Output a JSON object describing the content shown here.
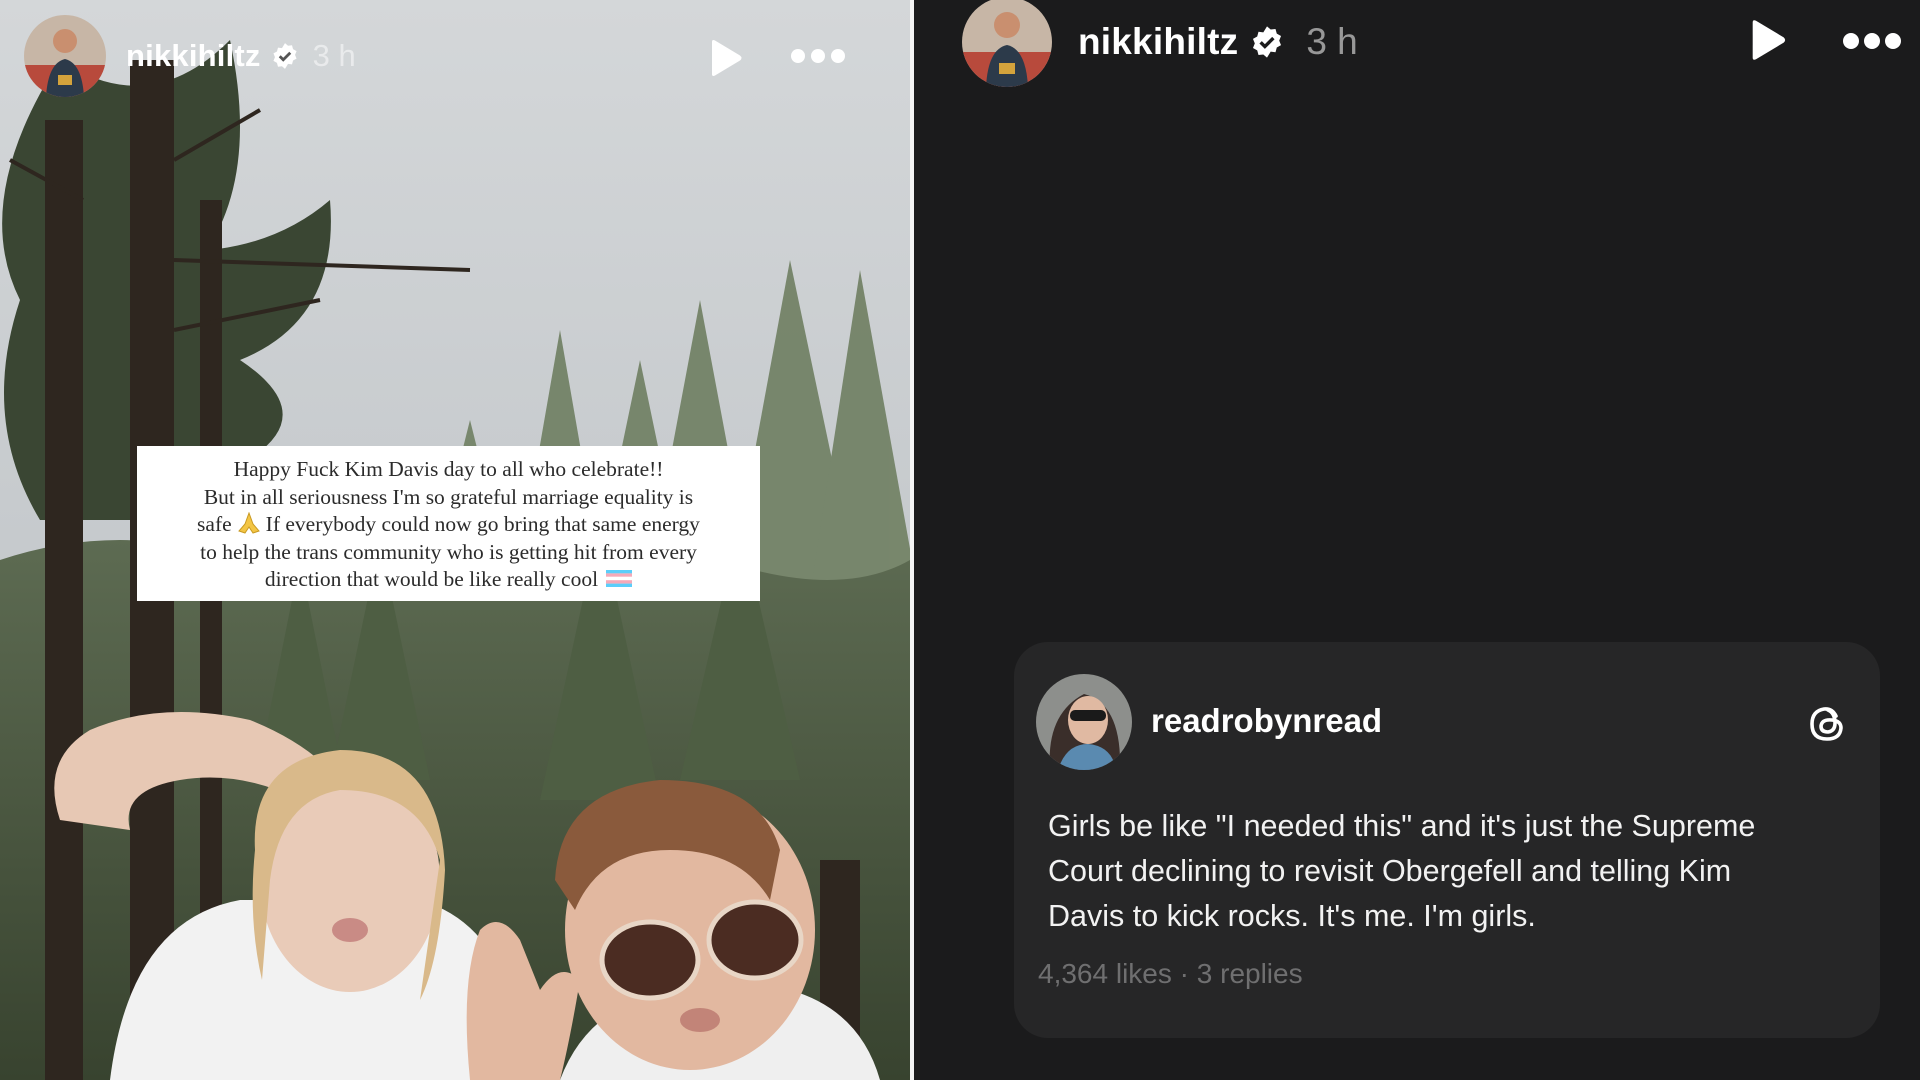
{
  "left_story": {
    "header": {
      "username": "nikkihiltz",
      "verified": true,
      "time": "3 h"
    },
    "controls": {
      "play_icon": "play-icon",
      "more_icon": "more-icon"
    },
    "text_sticker": {
      "lines": [
        "Happy Fuck Kim Davis day to all who celebrate!!",
        "But in all seriousness I'm so grateful marriage equality is",
        "safe",
        "If everybody could now go bring that same energy",
        "to help the trans community who is getting hit from every",
        "direction that would be like really cool"
      ],
      "emoji": [
        "folded-hands-emoji",
        "transgender-flag-emoji"
      ]
    }
  },
  "right_story": {
    "header": {
      "username": "nikkihiltz",
      "verified": true,
      "time": "3 h"
    },
    "controls": {
      "play_icon": "play-icon",
      "more_icon": "more-icon"
    },
    "threads_post": {
      "username": "readrobynread",
      "text_lines": [
        "Girls be like \"I needed this\" and it's just the Supreme",
        "Court declining to revisit Obergefell and telling Kim",
        "Davis to kick rocks. It's me. I'm girls."
      ],
      "likes": "4,364 likes",
      "separator": "·",
      "replies": "3 replies",
      "platform_icon": "threads-icon"
    }
  },
  "colors": {
    "right_bg": "#1b1b1c",
    "card_bg": "#262627",
    "meta_text": "#6f6f70",
    "sticker_bg": "#ffffff"
  }
}
